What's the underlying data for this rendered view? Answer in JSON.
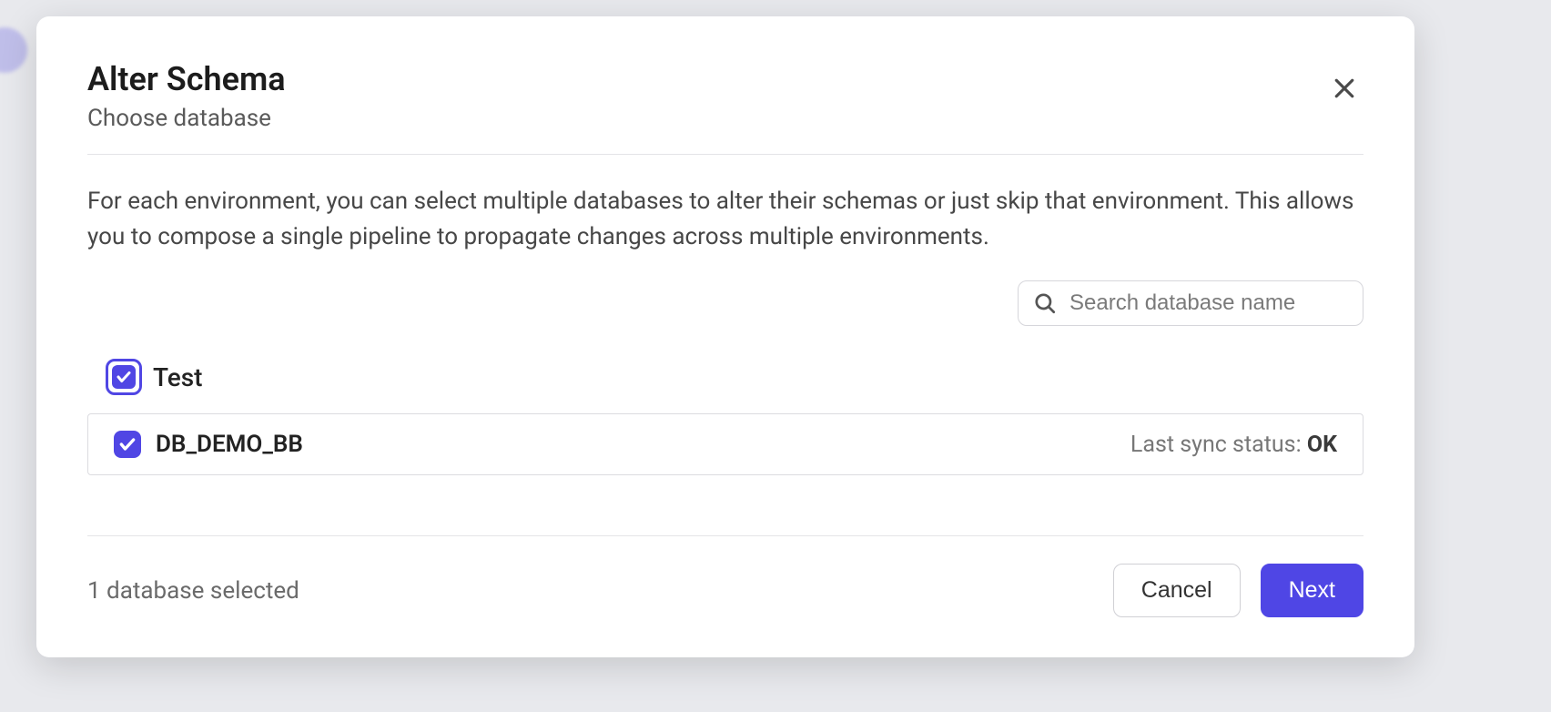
{
  "modal": {
    "title": "Alter Schema",
    "subtitle": "Choose database",
    "description": "For each environment, you can select multiple databases to alter their schemas or just skip that environment. This allows you to compose a single pipeline to propagate changes across multiple environments.",
    "search_placeholder": "Search database name",
    "environments": [
      {
        "name": "Test",
        "checked": true,
        "databases": [
          {
            "name": "DB_DEMO_BB",
            "checked": true,
            "sync_label": "Last sync status: ",
            "sync_value": "OK"
          }
        ]
      }
    ],
    "selected_text": "1 database selected",
    "buttons": {
      "cancel": "Cancel",
      "next": "Next"
    }
  }
}
